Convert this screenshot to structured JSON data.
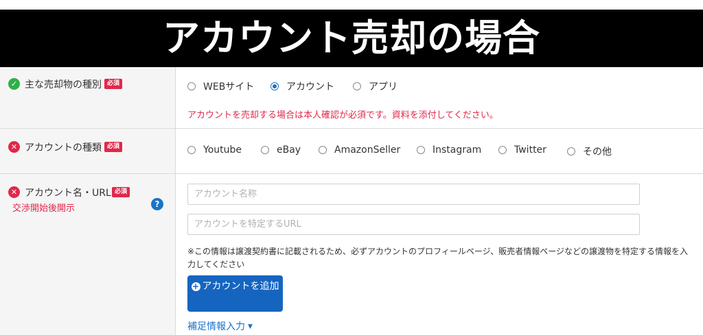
{
  "banner": {
    "title": "アカウント売却の場合"
  },
  "row_sale_item": {
    "label": "主な売却物の種別",
    "required": "必須",
    "options": [
      "WEBサイト",
      "アカウント",
      "アプリ"
    ],
    "selected": "アカウント",
    "warning": "アカウントを売却する場合は本人確認が必須です。資料を添付してください。"
  },
  "row_account_type": {
    "label": "アカウントの種類",
    "required": "必須",
    "options": [
      "Youtube",
      "eBay",
      "AmazonSeller",
      "Instagram",
      "Twitter",
      "その他"
    ]
  },
  "row_account_name": {
    "label": "アカウント名・URL",
    "required": "必須",
    "note": "交渉開始後開示",
    "name_placeholder": "アカウント名称",
    "url_placeholder": "アカウントを特定するURL",
    "description": "※この情報は譲渡契約書に記載されるため、必ずアカウントのプロフィールページ、販売者情報ページなどの譲渡物を特定する情報を入力してください",
    "add_button": "アカウントを追加",
    "more_link": "補足情報入力"
  },
  "icons": {
    "ok": "check-circle-icon",
    "error": "x-circle-icon",
    "help": "question-circle-icon"
  },
  "colors": {
    "accent": "#1565c0",
    "required": "#e0284a",
    "ok": "#2eaf4a"
  }
}
